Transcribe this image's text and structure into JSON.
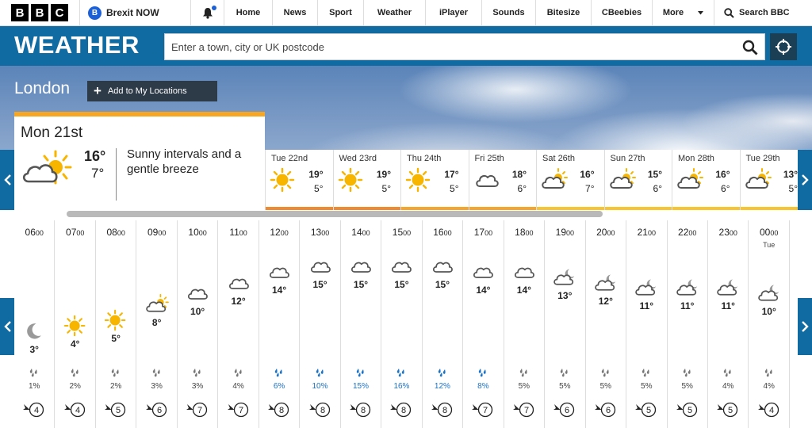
{
  "nav": {
    "brexit_label": "Brexit NOW",
    "items": [
      "Home",
      "News",
      "Sport",
      "Weather",
      "iPlayer",
      "Sounds",
      "Bitesize",
      "CBeebies",
      "More"
    ],
    "search_label": "Search BBC"
  },
  "header": {
    "title": "WEATHER",
    "search_placeholder": "Enter a town, city or UK postcode"
  },
  "location": {
    "city": "London",
    "add_label": "Add to My Locations"
  },
  "today": {
    "day": "Mon 21st",
    "high": "16°",
    "low": "7°",
    "description": "Sunny intervals and a gentle breeze",
    "icon": "sunny-intervals-icon",
    "accent": "#f6a623"
  },
  "days": [
    {
      "name": "Tue 22nd",
      "high": "19°",
      "low": "5°",
      "icon": "sun",
      "color": "#ef8a2e"
    },
    {
      "name": "Wed 23rd",
      "high": "19°",
      "low": "5°",
      "icon": "sun",
      "color": "#ef8a2e"
    },
    {
      "name": "Thu 24th",
      "high": "17°",
      "low": "5°",
      "icon": "sun",
      "color": "#f5a52b"
    },
    {
      "name": "Fri 25th",
      "high": "18°",
      "low": "6°",
      "icon": "cloud",
      "color": "#f5a52b"
    },
    {
      "name": "Sat 26th",
      "high": "16°",
      "low": "7°",
      "icon": "sunny-intervals",
      "color": "#f7c531"
    },
    {
      "name": "Sun 27th",
      "high": "15°",
      "low": "6°",
      "icon": "sunny-intervals",
      "color": "#f7c531"
    },
    {
      "name": "Mon 28th",
      "high": "16°",
      "low": "6°",
      "icon": "sunny-intervals",
      "color": "#f7c531"
    },
    {
      "name": "Tue 29th",
      "high": "13°",
      "low": "5°",
      "icon": "sunny-intervals",
      "color": "#f7c531"
    }
  ],
  "hours": [
    {
      "time": "06",
      "sub": "",
      "icon": "moon",
      "temp": "3°",
      "level": 3,
      "precip": "1%",
      "rain": false,
      "wind": "4"
    },
    {
      "time": "07",
      "sub": "",
      "icon": "sun",
      "temp": "4°",
      "level": 4,
      "precip": "2%",
      "rain": false,
      "wind": "4"
    },
    {
      "time": "08",
      "sub": "",
      "icon": "sun",
      "temp": "5°",
      "level": 5,
      "precip": "2%",
      "rain": false,
      "wind": "5"
    },
    {
      "time": "09",
      "sub": "",
      "icon": "sunny-intervals",
      "temp": "8°",
      "level": 8,
      "precip": "3%",
      "rain": false,
      "wind": "6"
    },
    {
      "time": "10",
      "sub": "",
      "icon": "cloud",
      "temp": "10°",
      "level": 10,
      "precip": "3%",
      "rain": false,
      "wind": "7"
    },
    {
      "time": "11",
      "sub": "",
      "icon": "cloud",
      "temp": "12°",
      "level": 12,
      "precip": "4%",
      "rain": false,
      "wind": "7"
    },
    {
      "time": "12",
      "sub": "",
      "icon": "cloud",
      "temp": "14°",
      "level": 14,
      "precip": "6%",
      "rain": true,
      "wind": "8"
    },
    {
      "time": "13",
      "sub": "",
      "icon": "cloud",
      "temp": "15°",
      "level": 15,
      "precip": "10%",
      "rain": true,
      "wind": "8"
    },
    {
      "time": "14",
      "sub": "",
      "icon": "cloud",
      "temp": "15°",
      "level": 15,
      "precip": "15%",
      "rain": true,
      "wind": "8"
    },
    {
      "time": "15",
      "sub": "",
      "icon": "cloud",
      "temp": "15°",
      "level": 15,
      "precip": "16%",
      "rain": true,
      "wind": "8"
    },
    {
      "time": "16",
      "sub": "",
      "icon": "cloud",
      "temp": "15°",
      "level": 15,
      "precip": "12%",
      "rain": true,
      "wind": "8"
    },
    {
      "time": "17",
      "sub": "",
      "icon": "cloud",
      "temp": "14°",
      "level": 14,
      "precip": "8%",
      "rain": true,
      "wind": "7"
    },
    {
      "time": "18",
      "sub": "",
      "icon": "cloud",
      "temp": "14°",
      "level": 14,
      "precip": "5%",
      "rain": false,
      "wind": "7"
    },
    {
      "time": "19",
      "sub": "",
      "icon": "cloud-moon",
      "temp": "13°",
      "level": 13,
      "precip": "5%",
      "rain": false,
      "wind": "6"
    },
    {
      "time": "20",
      "sub": "",
      "icon": "cloud-moon",
      "temp": "12°",
      "level": 12,
      "precip": "5%",
      "rain": false,
      "wind": "6"
    },
    {
      "time": "21",
      "sub": "",
      "icon": "cloud-moon",
      "temp": "11°",
      "level": 11,
      "precip": "5%",
      "rain": false,
      "wind": "5"
    },
    {
      "time": "22",
      "sub": "",
      "icon": "cloud-moon",
      "temp": "11°",
      "level": 11,
      "precip": "5%",
      "rain": false,
      "wind": "5"
    },
    {
      "time": "23",
      "sub": "",
      "icon": "cloud-moon",
      "temp": "11°",
      "level": 11,
      "precip": "4%",
      "rain": false,
      "wind": "5"
    },
    {
      "time": "00",
      "sub": "Tue",
      "icon": "cloud-moon",
      "temp": "10°",
      "level": 10,
      "precip": "4%",
      "rain": false,
      "wind": "4"
    }
  ],
  "colors": {
    "brand_blue": "#0f6ba1",
    "sun": "#f7b500",
    "rain": "#1a73c8"
  }
}
